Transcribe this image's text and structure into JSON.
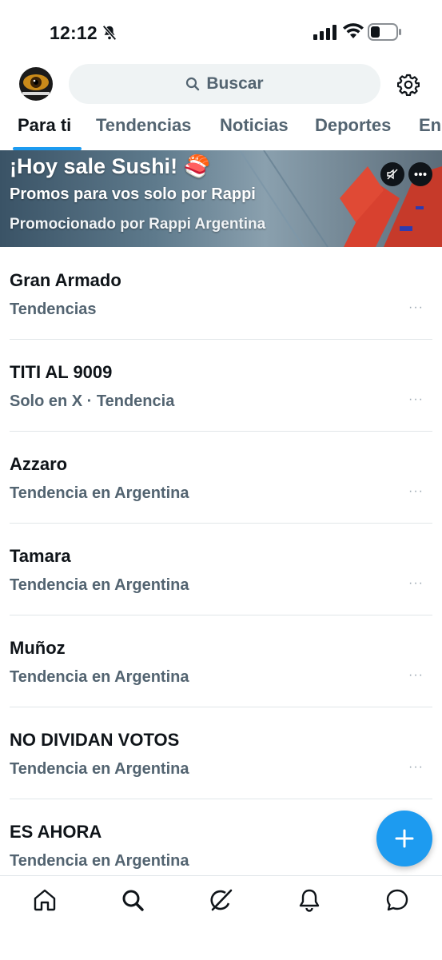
{
  "status_bar": {
    "time": "12:12",
    "icons": [
      "bell-off-icon",
      "signal-icon",
      "wifi-icon",
      "battery-icon"
    ]
  },
  "header": {
    "avatar_icon": "avatar",
    "search_label": "Buscar",
    "settings_icon": "gear-icon"
  },
  "tabs": [
    {
      "label": "Para ti",
      "active": true
    },
    {
      "label": "Tendencias",
      "active": false
    },
    {
      "label": "Noticias",
      "active": false
    },
    {
      "label": "Deportes",
      "active": false
    },
    {
      "label": "En",
      "active": false
    }
  ],
  "promo": {
    "title": "¡Hoy sale Sushi! 🍣",
    "subtitle": "Promos para vos solo por Rappi",
    "promoted_by": "Promocionado por Rappi Argentina"
  },
  "trends": [
    {
      "title": "Gran Armado",
      "meta": "Tendencias",
      "more": "···"
    },
    {
      "title": "TITI AL 9009",
      "meta": "Solo en X · Tendencia",
      "more": "···"
    },
    {
      "title": "Azzaro",
      "meta": "Tendencia en Argentina",
      "more": "···"
    },
    {
      "title": "Tamara",
      "meta": "Tendencia en Argentina",
      "more": "···"
    },
    {
      "title": "Muñoz",
      "meta": "Tendencia en Argentina",
      "more": "···"
    },
    {
      "title": "NO DIVIDAN VOTOS",
      "meta": "Tendencia en Argentina",
      "more": "···"
    },
    {
      "title": "ES AHORA",
      "meta": "Tendencia en Argentina",
      "more": ""
    }
  ],
  "colors": {
    "accent": "#1d9bf0",
    "text": "#0f1419",
    "muted": "#536471"
  },
  "bottom_nav": [
    "home-icon",
    "search-icon",
    "grok-icon",
    "bell-icon",
    "messages-icon"
  ]
}
